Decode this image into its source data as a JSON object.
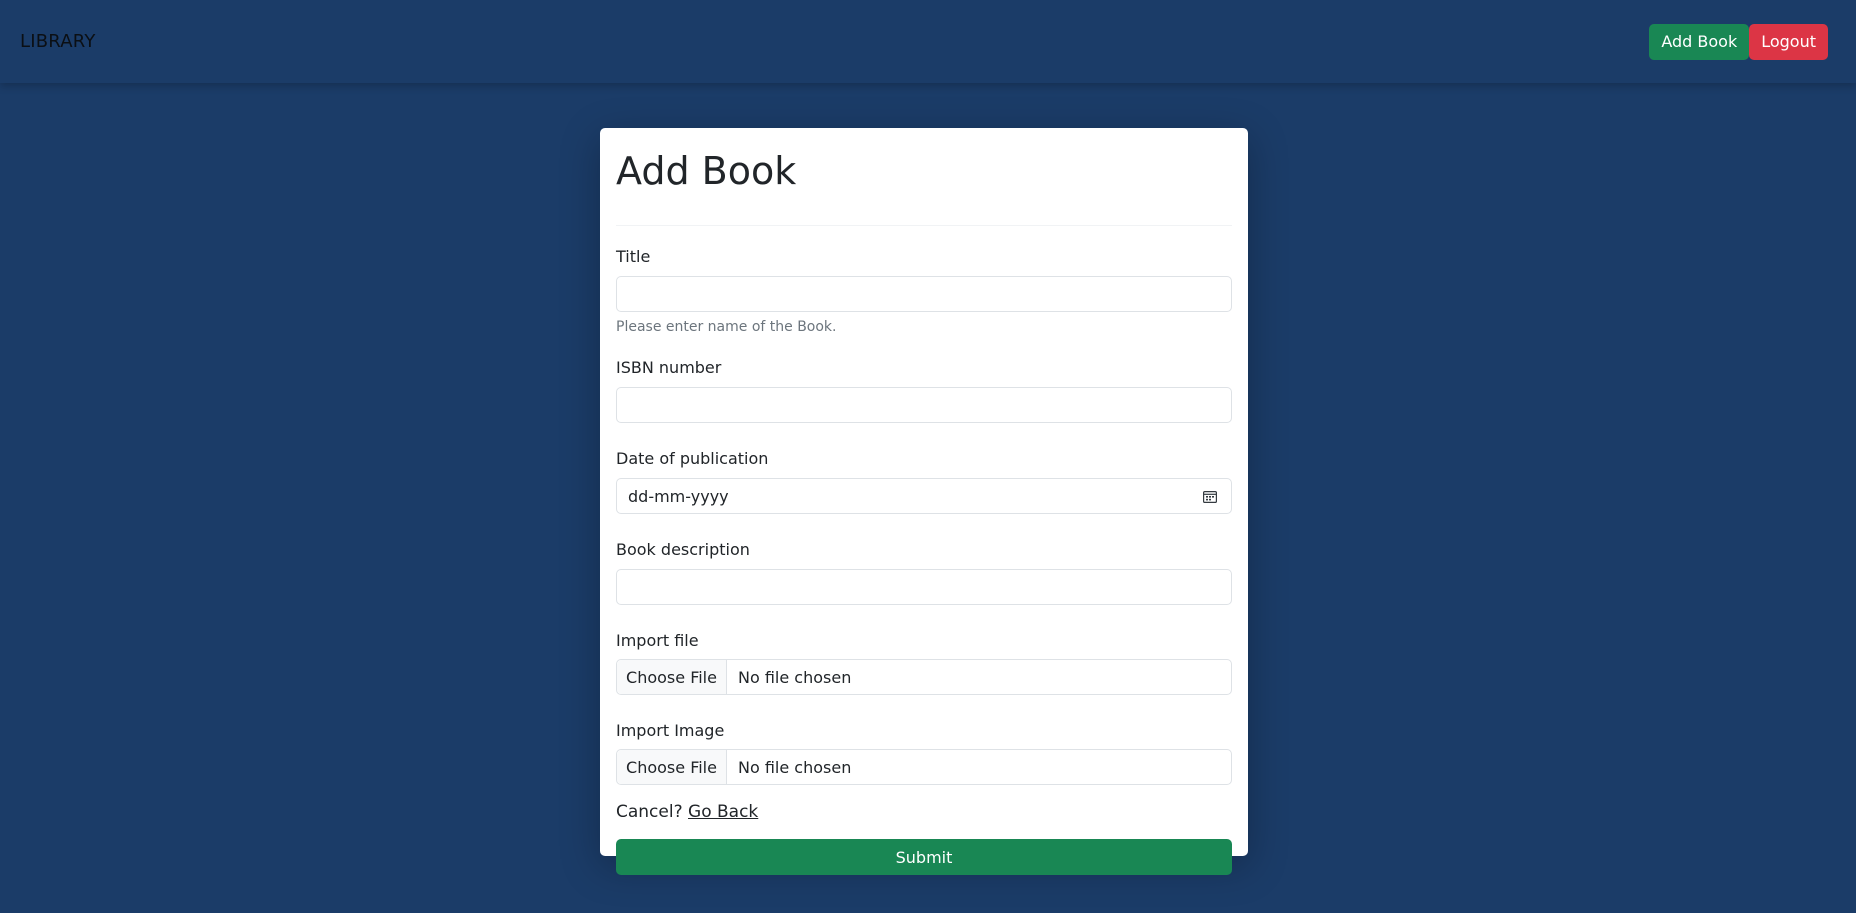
{
  "navbar": {
    "brand": "LIBRARY",
    "add_book_label": "Add Book",
    "logout_label": "Logout"
  },
  "form": {
    "heading": "Add Book",
    "title_label": "Title",
    "title_value": "",
    "title_help": "Please enter name of the Book.",
    "isbn_label": "ISBN number",
    "isbn_value": "",
    "date_label": "Date of publication",
    "date_placeholder": "dd-mm-yyyy",
    "description_label": "Book description",
    "description_value": "",
    "import_file_label": "Import file",
    "import_file_button": "Choose File",
    "import_file_status": "No file chosen",
    "import_image_label": "Import Image",
    "import_image_button": "Choose File",
    "import_image_status": "No file chosen",
    "cancel_text": "Cancel?",
    "go_back_label": "Go Back",
    "submit_label": "Submit"
  },
  "icons": {
    "date_picker": "calendar-icon"
  },
  "colors": {
    "background": "#1b3c68",
    "success": "#198754",
    "danger": "#dc3545",
    "card": "#ffffff"
  }
}
